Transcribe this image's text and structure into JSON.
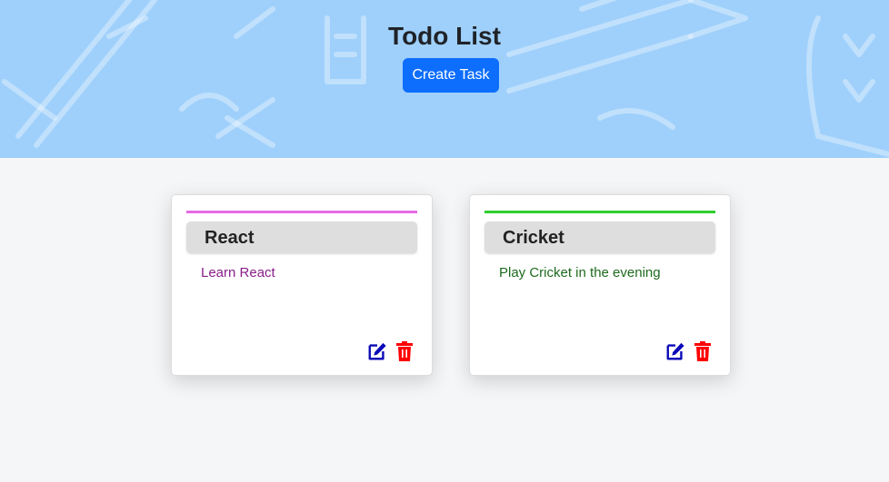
{
  "header": {
    "title": "Todo List",
    "create_button": "Create Task",
    "background_color": "#9fd0fb"
  },
  "tasks": [
    {
      "name": "React",
      "description": "Learn React",
      "accent_color": "#e66be6",
      "text_color": "#8a1f8a",
      "actions": [
        "edit-icon",
        "trash-icon"
      ]
    },
    {
      "name": "Cricket",
      "description": "Play Cricket in the evening",
      "accent_color": "#2fcf2f",
      "text_color": "#1e6a1e",
      "actions": [
        "edit-icon",
        "trash-icon"
      ]
    }
  ],
  "colors": {
    "edit_icon": "#0a0ab8",
    "delete_icon": "#ff0000",
    "primary_button": "#0d6efd"
  }
}
